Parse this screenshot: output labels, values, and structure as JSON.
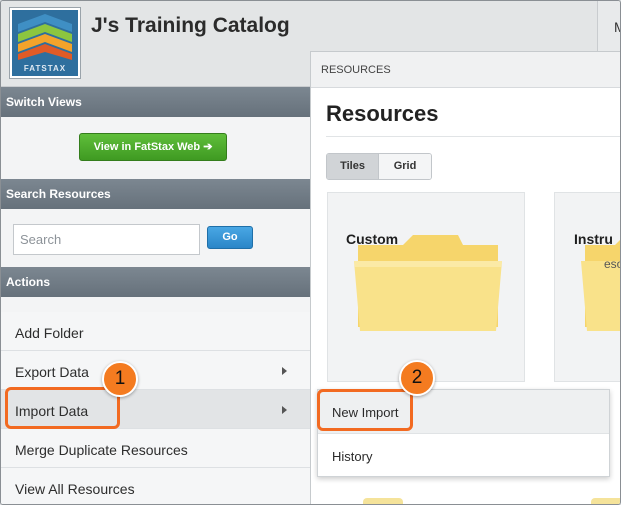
{
  "header": {
    "logo_text": "FATSTAX",
    "title": "J's Training Catalog",
    "top_right_letter": "M"
  },
  "sidebar": {
    "switch_views": {
      "heading": "Switch Views",
      "button_label": "View in FatStax Web ➔"
    },
    "search": {
      "heading": "Search Resources",
      "placeholder": "Search",
      "go_label": "Go"
    },
    "actions": {
      "heading": "Actions",
      "items": [
        {
          "label": "Add Folder"
        },
        {
          "label": "Export Data"
        },
        {
          "label": "Import Data"
        },
        {
          "label": "Merge Duplicate Resources"
        },
        {
          "label": "View All Resources"
        }
      ]
    }
  },
  "resources": {
    "breadcrumb": "RESOURCES",
    "title": "Resources",
    "view_tabs": [
      "Tiles",
      "Grid"
    ],
    "selected_view": "Tiles",
    "tiles": [
      {
        "label": "Custom"
      },
      {
        "label": "Instru",
        "sub": "eso"
      }
    ]
  },
  "import_menu": {
    "items": [
      {
        "label": "New Import"
      },
      {
        "label": "History"
      }
    ]
  },
  "annotations": {
    "step1": "1",
    "step2": "2",
    "color": "#f26a21"
  },
  "colors": {
    "green_button": "#4caf2c",
    "go_button": "#2e8bcf",
    "section_header": "#707b85",
    "folder": "#f8de7e"
  }
}
